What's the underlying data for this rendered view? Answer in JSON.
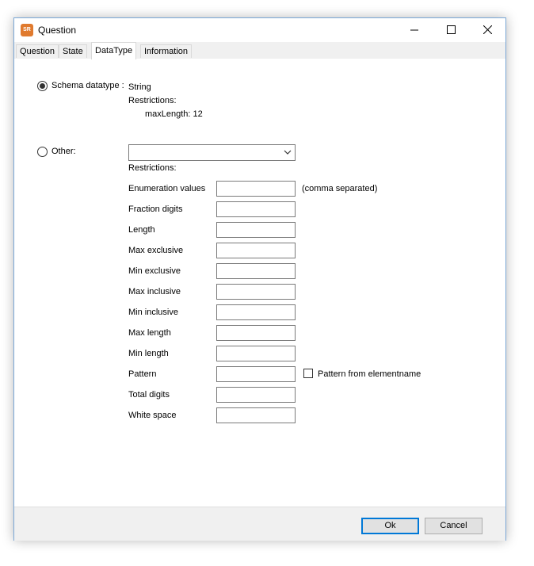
{
  "window": {
    "title": "Question",
    "app_icon_text": "SR"
  },
  "tabs": [
    {
      "label": "Question"
    },
    {
      "label": "State"
    },
    {
      "label": "DataType"
    },
    {
      "label": "Information"
    }
  ],
  "schema": {
    "radio_label": "Schema datatype :",
    "selected": true,
    "type_value": "String",
    "restrictions_label": "Restrictions:",
    "restriction_value": "maxLength: 12"
  },
  "other": {
    "radio_label": "Other:",
    "selected": false,
    "dropdown_value": "",
    "restrictions_label": "Restrictions:"
  },
  "fields": [
    {
      "label": "Enumeration values",
      "value": ""
    },
    {
      "label": "Fraction digits",
      "value": ""
    },
    {
      "label": "Length",
      "value": ""
    },
    {
      "label": "Max exclusive",
      "value": ""
    },
    {
      "label": "Min exclusive",
      "value": ""
    },
    {
      "label": "Max inclusive",
      "value": ""
    },
    {
      "label": "Min inclusive",
      "value": ""
    },
    {
      "label": "Max length",
      "value": ""
    },
    {
      "label": "Min length",
      "value": ""
    },
    {
      "label": "Pattern",
      "value": ""
    },
    {
      "label": "Total digits",
      "value": ""
    },
    {
      "label": "White space",
      "value": ""
    }
  ],
  "hints": {
    "enumeration_hint": "(comma separated)",
    "pattern_checkbox_label": "Pattern from elementname",
    "pattern_checkbox_checked": false
  },
  "buttons": {
    "ok": "Ok",
    "cancel": "Cancel"
  },
  "icons": {
    "minimize": "minimize-icon",
    "maximize": "maximize-icon",
    "close": "close-icon",
    "dropdown": "chevron-down-icon"
  }
}
